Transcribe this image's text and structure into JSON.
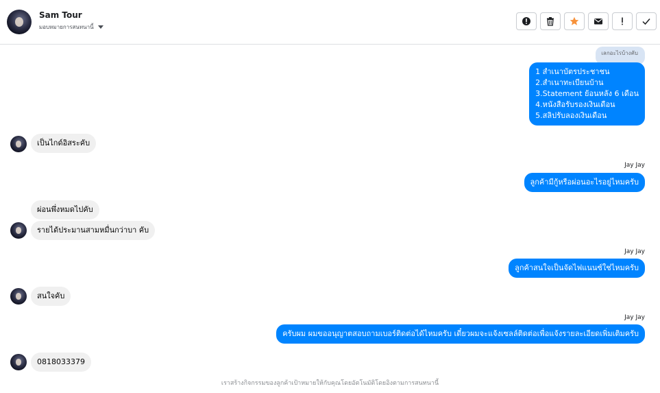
{
  "header": {
    "contact_name": "Sam Tour",
    "assign_label": "มอบหมายการสนทนานี้",
    "actions": [
      {
        "name": "spam",
        "icon": "alert-circle-icon"
      },
      {
        "name": "delete",
        "icon": "trash-icon"
      },
      {
        "name": "star",
        "icon": "star-icon",
        "color": "#f7923b"
      },
      {
        "name": "mark-unread",
        "icon": "envelope-icon"
      },
      {
        "name": "follow-up",
        "icon": "exclamation-icon"
      },
      {
        "name": "done",
        "icon": "check-icon"
      }
    ]
  },
  "messages": {
    "reply_quote": "เลกอะไรบ้างคับ",
    "m1_lines": [
      "1 สำเนาบัตรประชาชน",
      "2.สำเนาทะเบียนบ้าน",
      "3.Statement ย้อนหลัง 6 เดือน",
      "4.หนังสือรับรองเงินเดือน",
      "5.สลิปรับลองเงินเดือน"
    ],
    "m2": "เป็นไกด์อิสระคับ",
    "m3_sender": "Jay Jay",
    "m3": "ลูกค้ามีกู้หรือผ่อนอะไรอยู่ไหมครับ",
    "m4": "ผ่อนพึ่งหมดไปคับ",
    "m5": "รายได้ประมานสามหมื่นกว่าบา คับ",
    "m6_sender": "Jay Jay",
    "m6": "ลูกค้าสนใจเป็นจัดไฟแนนซ์ใช่ไหมครับ",
    "m7": "สนใจคับ",
    "m8_sender": "Jay Jay",
    "m8": "ครับผม ผมขออนุญาตสอบถามเบอร์ติดต่อได้ไหมครับ เดี๋ยวผมจะแจ้งเซลล์ติดต่อเพื่อแจ้งรายละเอียดเพิ่มเติมครับ",
    "m9": "0818033379"
  },
  "footer_note": "เราสร้างกิจกรรมของลูกค้าเป้าหมายให้กับคุณโดยอัตโนมัติโดยอิงตามการสนทนานี้",
  "colors": {
    "outgoing": "#0084ff",
    "incoming": "#f0f0f0",
    "star": "#f7923b"
  }
}
